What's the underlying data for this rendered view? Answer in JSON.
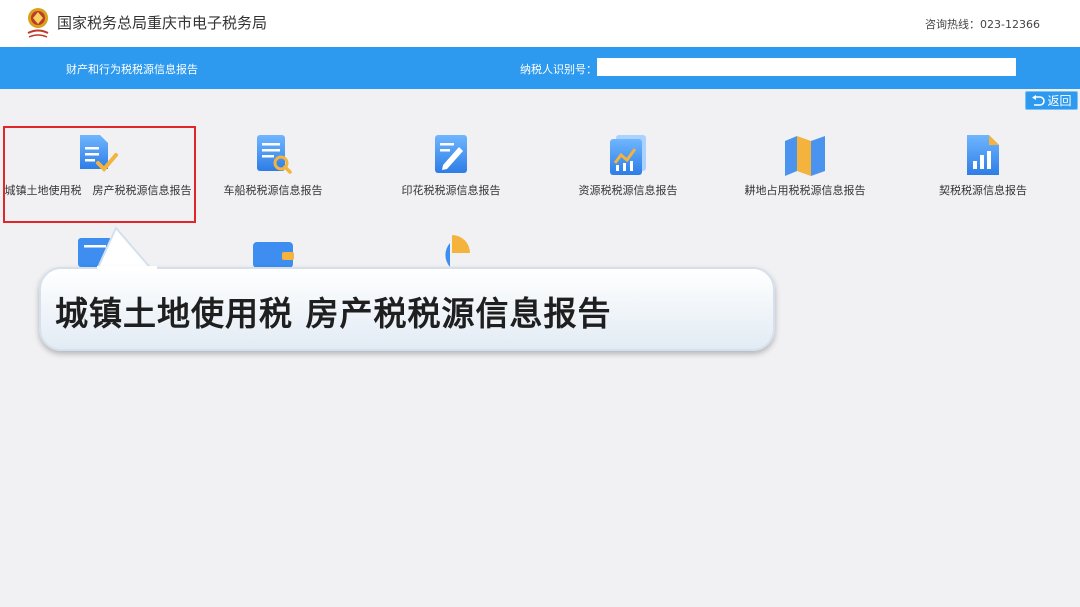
{
  "header": {
    "site_title": "国家税务总局重庆市电子税务局",
    "hotline": "咨询热线：023-12366"
  },
  "toolbar": {
    "page_label": "财产和行为税税源信息报告",
    "taxpayer_id_label": "纳税人识别号：",
    "taxpayer_id_value": "",
    "back_label": "返回"
  },
  "tiles": [
    {
      "label": "城镇土地使用税　房产税税源信息报告",
      "icon": "document-check-icon"
    },
    {
      "label": "车船税税源信息报告",
      "icon": "document-search-icon"
    },
    {
      "label": "印花税税源信息报告",
      "icon": "document-edit-icon"
    },
    {
      "label": "资源税税源信息报告",
      "icon": "chart-document-icon"
    },
    {
      "label": "耕地占用税税源信息报告",
      "icon": "map-icon"
    },
    {
      "label": "契税税源信息报告",
      "icon": "bar-chart-document-icon"
    }
  ],
  "callout": {
    "text": "城镇土地使用税 房产税税源信息报告"
  },
  "colors": {
    "primary_blue": "#2d9af0",
    "highlight_red": "#e0262b",
    "background": "#f1f1f4"
  }
}
